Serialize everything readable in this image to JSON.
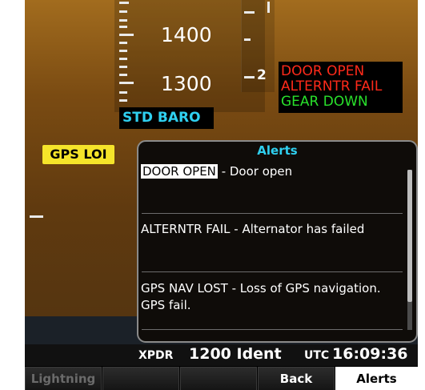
{
  "altitude_tape": {
    "labels": [
      "1400",
      "1300"
    ],
    "vsi_label": "2"
  },
  "baro_setting": "STD BARO",
  "annunciator_box": {
    "lines": [
      {
        "text": "DOOR OPEN",
        "color": "#ff2a1a"
      },
      {
        "text": "ALTERNTR FAIL",
        "color": "#ff2a1a"
      },
      {
        "text": "GEAR DOWN",
        "color": "#29e02b"
      }
    ]
  },
  "gps_annunciation": "GPS LOI",
  "alerts_window": {
    "title": "Alerts",
    "items": [
      {
        "code": "DOOR OPEN",
        "message": "- Door open",
        "selected": true
      },
      {
        "code": "ALTERNTR FAIL",
        "message": "- Alternator has failed",
        "selected": false
      },
      {
        "code": "GPS NAV LOST",
        "message": "- Loss of GPS navigation. GPS fail.",
        "selected": false
      }
    ]
  },
  "status_bar": {
    "xpdr_label": "XPDR",
    "xpdr_value": "1200 Ident",
    "utc_label": "UTC",
    "utc_value": "16:09:36"
  },
  "softkeys": [
    {
      "label": "Lightning",
      "state": "disabled"
    },
    {
      "label": "",
      "state": "normal"
    },
    {
      "label": "",
      "state": "normal"
    },
    {
      "label": "Back",
      "state": "normal"
    },
    {
      "label": "Alerts",
      "state": "active"
    }
  ],
  "colors": {
    "cyan_accent": "#2fd0f0",
    "warning_red": "#ff2a1a",
    "advisory_green": "#29e02b",
    "caution_yellow": "#f5e42a"
  }
}
